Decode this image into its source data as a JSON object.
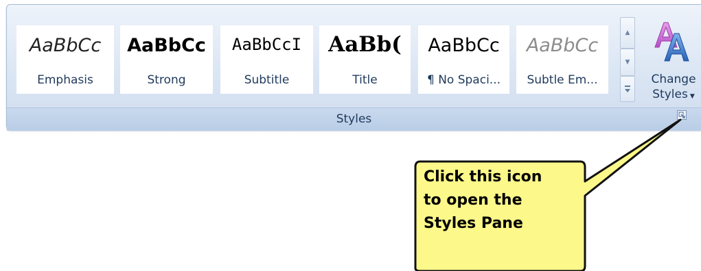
{
  "gallery": {
    "tiles": [
      {
        "sample": "AaBbCc",
        "label": "Emphasis"
      },
      {
        "sample": "AaBbCc",
        "label": "Strong"
      },
      {
        "sample": "AaBbCcI",
        "label": "Subtitle"
      },
      {
        "sample": "AaBb(",
        "label": "Title"
      },
      {
        "sample": "AaBbCc",
        "label": "¶ No Spaci..."
      },
      {
        "sample": "AaBbCc",
        "label": "Subtle Em..."
      }
    ]
  },
  "change_styles": {
    "line1": "Change",
    "line2": "Styles"
  },
  "group": {
    "label": "Styles"
  },
  "callout": {
    "line1": "Click this icon",
    "line2": "to open the",
    "line3": "Styles Pane"
  },
  "colors": {
    "callout_fill": "#fcf88a",
    "ribbon_label": "#1e395b"
  },
  "icons": {
    "scroll_up": "triangle-up",
    "scroll_down": "triangle-down",
    "more": "expand-gallery",
    "change_styles": "styled-letter-a",
    "launcher": "dialog-launcher"
  }
}
